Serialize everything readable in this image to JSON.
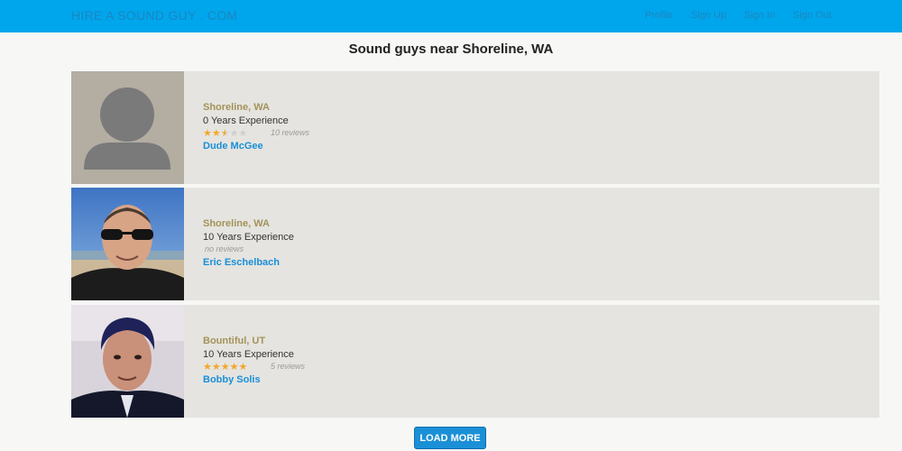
{
  "navbar": {
    "brand": "HIRE A SOUND GUY . COM",
    "links": [
      "Profile",
      "Sign Up",
      "Sign In",
      "Sign Out"
    ]
  },
  "page_title": "Sound guys near Shoreline, WA",
  "listings": [
    {
      "location": "Shoreline, WA",
      "experience": "0 Years Experience",
      "rating": 2.5,
      "max_rating": 5,
      "reviews": "10 reviews",
      "name": "Dude McGee",
      "photo": "default-avatar-icon"
    },
    {
      "location": "Shoreline, WA",
      "experience": "10 Years Experience",
      "rating": 0,
      "max_rating": 5,
      "reviews": "no reviews",
      "name": "Eric Eschelbach",
      "photo": "user-photo"
    },
    {
      "location": "Bountiful, UT",
      "experience": "10 Years Experience",
      "rating": 5,
      "max_rating": 5,
      "reviews": "5 reviews",
      "name": "Bobby Solis",
      "photo": "user-photo"
    }
  ],
  "load_more_label": "LOAD MORE",
  "colors": {
    "navbar": "#00a6ec",
    "accent": "#1a8fd8",
    "location": "#a3935a",
    "star": "#f4a62a"
  }
}
